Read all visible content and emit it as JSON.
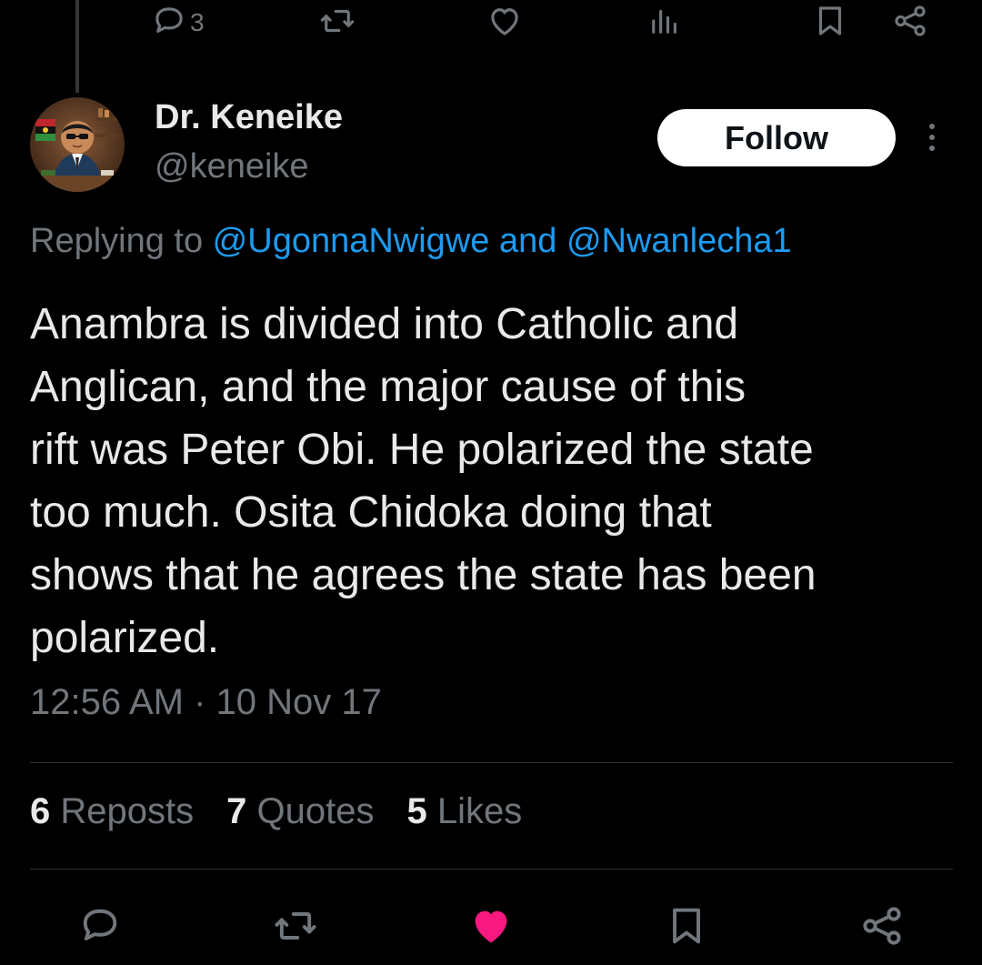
{
  "previous_tweet": {
    "reply_count": "3"
  },
  "author": {
    "name": "Dr. Keneike",
    "handle": "@keneike"
  },
  "follow_label": "Follow",
  "reply_context": {
    "prefix": "Replying to ",
    "mention_1": "@UgonnaNwigwe",
    "joiner": " and ",
    "mention_2": "@Nwanlecha1"
  },
  "tweet": {
    "text": "Anambra is divided into Catholic and\nAnglican, and the major cause of this\nrift was Peter Obi. He polarized the state\ntoo much. Osita Chidoka doing that\nshows that he agrees the state has been\npolarized.",
    "timestamp": "12:56 AM · 10 Nov 17"
  },
  "stats": {
    "reposts_count": "6",
    "reposts_label": "Reposts",
    "quotes_count": "7",
    "quotes_label": "Quotes",
    "likes_count": "5",
    "likes_label": "Likes"
  },
  "colors": {
    "background": "#000000",
    "text_primary": "#e7e9ea",
    "text_secondary": "#71767b",
    "link": "#1d9bf0",
    "like_active": "#f91880",
    "divider": "#2f3336"
  },
  "icons": {
    "prev_actions": [
      "reply-icon",
      "repost-icon",
      "like-icon",
      "analytics-icon",
      "bookmark-icon",
      "share-icon"
    ],
    "actions": [
      "reply-icon",
      "repost-icon",
      "like-filled-icon",
      "bookmark-icon",
      "share-icon"
    ],
    "more": "more-vertical-icon"
  }
}
